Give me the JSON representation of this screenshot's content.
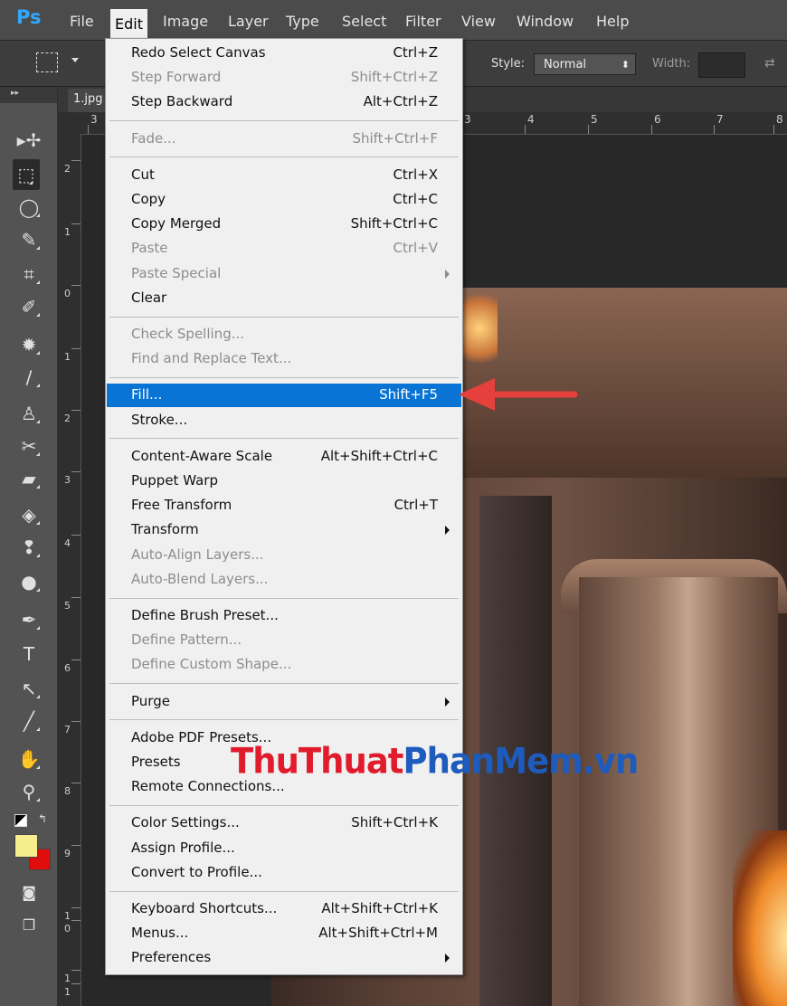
{
  "menubar": {
    "logo": "Ps",
    "items": [
      "File",
      "Edit",
      "Image",
      "Layer",
      "Type",
      "Select",
      "Filter",
      "View",
      "Window",
      "Help"
    ]
  },
  "options": {
    "style_label": "Style:",
    "style_value": "Normal",
    "width_label": "Width:"
  },
  "document": {
    "tab": "1.jpg"
  },
  "ruler_top": [
    "3",
    "3",
    "4",
    "5",
    "6",
    "7",
    "8"
  ],
  "ruler_left": [
    "2",
    "1",
    "0",
    "1",
    "2",
    "3",
    "4",
    "5",
    "6",
    "7",
    "8",
    "9",
    "1",
    "0",
    "1",
    "1"
  ],
  "edit_menu": {
    "groups": [
      [
        {
          "label": "Redo Select Canvas",
          "shortcut": "Ctrl+Z"
        },
        {
          "label": "Step Forward",
          "shortcut": "Shift+Ctrl+Z",
          "disabled": true
        },
        {
          "label": "Step Backward",
          "shortcut": "Alt+Ctrl+Z"
        }
      ],
      [
        {
          "label": "Fade...",
          "shortcut": "Shift+Ctrl+F",
          "disabled": true
        }
      ],
      [
        {
          "label": "Cut",
          "shortcut": "Ctrl+X"
        },
        {
          "label": "Copy",
          "shortcut": "Ctrl+C"
        },
        {
          "label": "Copy Merged",
          "shortcut": "Shift+Ctrl+C"
        },
        {
          "label": "Paste",
          "shortcut": "Ctrl+V",
          "disabled": true
        },
        {
          "label": "Paste Special",
          "submenu": true,
          "disabled": true
        },
        {
          "label": "Clear"
        }
      ],
      [
        {
          "label": "Check Spelling...",
          "disabled": true
        },
        {
          "label": "Find and Replace Text...",
          "disabled": true
        }
      ],
      [
        {
          "label": "Fill...",
          "shortcut": "Shift+F5",
          "highlighted": true
        },
        {
          "label": "Stroke..."
        }
      ],
      [
        {
          "label": "Content-Aware Scale",
          "shortcut": "Alt+Shift+Ctrl+C"
        },
        {
          "label": "Puppet Warp"
        },
        {
          "label": "Free Transform",
          "shortcut": "Ctrl+T"
        },
        {
          "label": "Transform",
          "submenu": true
        },
        {
          "label": "Auto-Align Layers...",
          "disabled": true
        },
        {
          "label": "Auto-Blend Layers...",
          "disabled": true
        }
      ],
      [
        {
          "label": "Define Brush Preset..."
        },
        {
          "label": "Define Pattern...",
          "disabled": true
        },
        {
          "label": "Define Custom Shape...",
          "disabled": true
        }
      ],
      [
        {
          "label": "Purge",
          "submenu": true
        }
      ],
      [
        {
          "label": "Adobe PDF Presets..."
        },
        {
          "label": "Presets"
        },
        {
          "label": "Remote Connections..."
        }
      ],
      [
        {
          "label": "Color Settings...",
          "shortcut": "Shift+Ctrl+K"
        },
        {
          "label": "Assign Profile..."
        },
        {
          "label": "Convert to Profile..."
        }
      ],
      [
        {
          "label": "Keyboard Shortcuts...",
          "shortcut": "Alt+Shift+Ctrl+K"
        },
        {
          "label": "Menus...",
          "shortcut": "Alt+Shift+Ctrl+M"
        },
        {
          "label": "Preferences",
          "submenu": true
        }
      ]
    ]
  },
  "tools": [
    "move-tool",
    "marquee-tool",
    "lasso-tool",
    "quick-selection-tool",
    "crop-tool",
    "eyedropper-tool",
    "healing-brush-tool",
    "brush-tool",
    "clone-stamp-tool",
    "history-brush-tool",
    "eraser-tool",
    "paint-bucket-tool",
    "blur-tool",
    "dodge-tool",
    "pen-tool",
    "type-tool",
    "path-selection-tool",
    "line-tool",
    "hand-tool",
    "zoom-tool"
  ],
  "colors": {
    "foreground": "#f6ed8d",
    "background": "#e10d0d",
    "highlight": "#0a74d4"
  },
  "watermark": {
    "part1": "ThuThuat",
    "part2": "PhanMem",
    "part3": ".vn"
  }
}
